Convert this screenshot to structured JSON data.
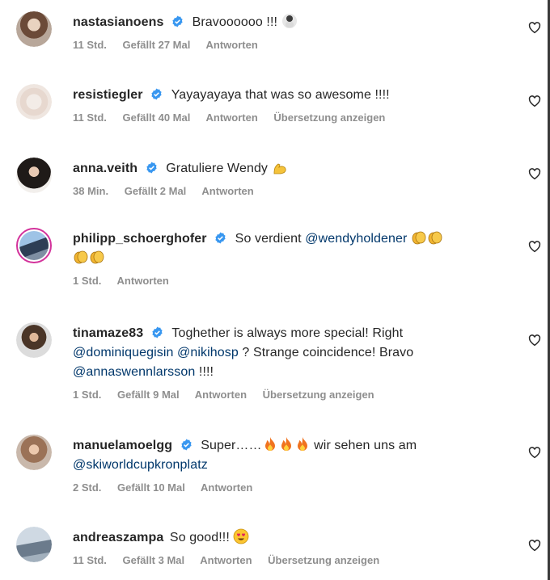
{
  "comments": [
    {
      "user": "nastasianoens",
      "text": "Bravoooooo !!! ",
      "meta": {
        "time": "11 Std.",
        "likes": "Gefällt 27 Mal",
        "reply": "Antworten"
      }
    },
    {
      "user": "resistiegler",
      "text": "Yayayayaya that was so awesome !!!!",
      "meta": {
        "time": "11 Std.",
        "likes": "Gefällt 40 Mal",
        "reply": "Antworten",
        "translate": "Übersetzung anzeigen"
      }
    },
    {
      "user": "anna.veith",
      "text": "Gratuliere Wendy ",
      "meta": {
        "time": "38 Min.",
        "likes": "Gefällt 2 Mal",
        "reply": "Antworten"
      }
    },
    {
      "user": "philipp_schoerghofer",
      "text": "So verdient ",
      "mention": "@wendyholdener",
      "meta": {
        "time": "1 Std.",
        "reply": "Antworten"
      }
    },
    {
      "user": "tinamaze83",
      "text1": "Toghether is always more special! Right",
      "mention1": "@dominiquegisin",
      "mention2": "@nikihosp",
      "text2": " ? Strange coincidence! Bravo",
      "mention3": "@annaswennlarsson",
      "text3": " !!!!",
      "meta": {
        "time": "1 Std.",
        "likes": "Gefällt 9 Mal",
        "reply": "Antworten",
        "translate": "Übersetzung anzeigen"
      }
    },
    {
      "user": "manuelamoelgg",
      "text1": "Super……",
      "text2": " wir sehen uns am",
      "mention": "@skiworldcupkronplatz",
      "meta": {
        "time": "2 Std.",
        "likes": "Gefällt 10 Mal",
        "reply": "Antworten"
      }
    },
    {
      "user": "andreaszampa",
      "text": "So good!!! ",
      "meta": {
        "time": "11 Std.",
        "likes": "Gefällt 3 Mal",
        "reply": "Antworten",
        "translate": "Übersetzung anzeigen"
      }
    }
  ],
  "icons": {
    "verified": "verified-badge-icon",
    "heart": "heart-outline-icon"
  },
  "colors": {
    "verified": "#3897f0",
    "mention": "#00376b",
    "meta": "#8e8e8e"
  }
}
